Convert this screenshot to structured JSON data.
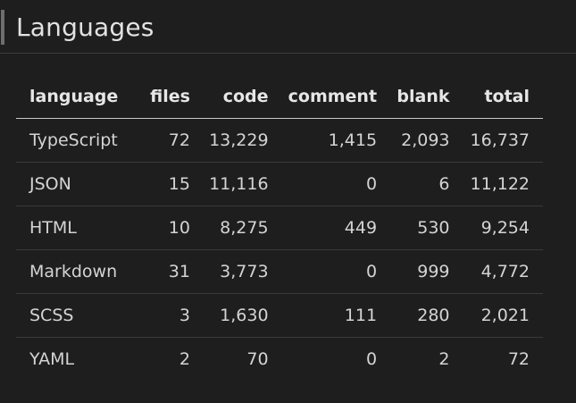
{
  "heading": "Languages",
  "table": {
    "columns": [
      "language",
      "files",
      "code",
      "comment",
      "blank",
      "total"
    ],
    "rows": [
      [
        "TypeScript",
        "72",
        "13,229",
        "1,415",
        "2,093",
        "16,737"
      ],
      [
        "JSON",
        "15",
        "11,116",
        "0",
        "6",
        "11,122"
      ],
      [
        "HTML",
        "10",
        "8,275",
        "449",
        "530",
        "9,254"
      ],
      [
        "Markdown",
        "31",
        "3,773",
        "0",
        "999",
        "4,772"
      ],
      [
        "SCSS",
        "3",
        "1,630",
        "111",
        "280",
        "2,021"
      ],
      [
        "YAML",
        "2",
        "70",
        "0",
        "2",
        "72"
      ]
    ]
  },
  "colors": {
    "background": "#1e1e1e",
    "text": "#d4d4d4",
    "heading_bar": "#6e6e6e",
    "divider": "#3a3a3a"
  }
}
